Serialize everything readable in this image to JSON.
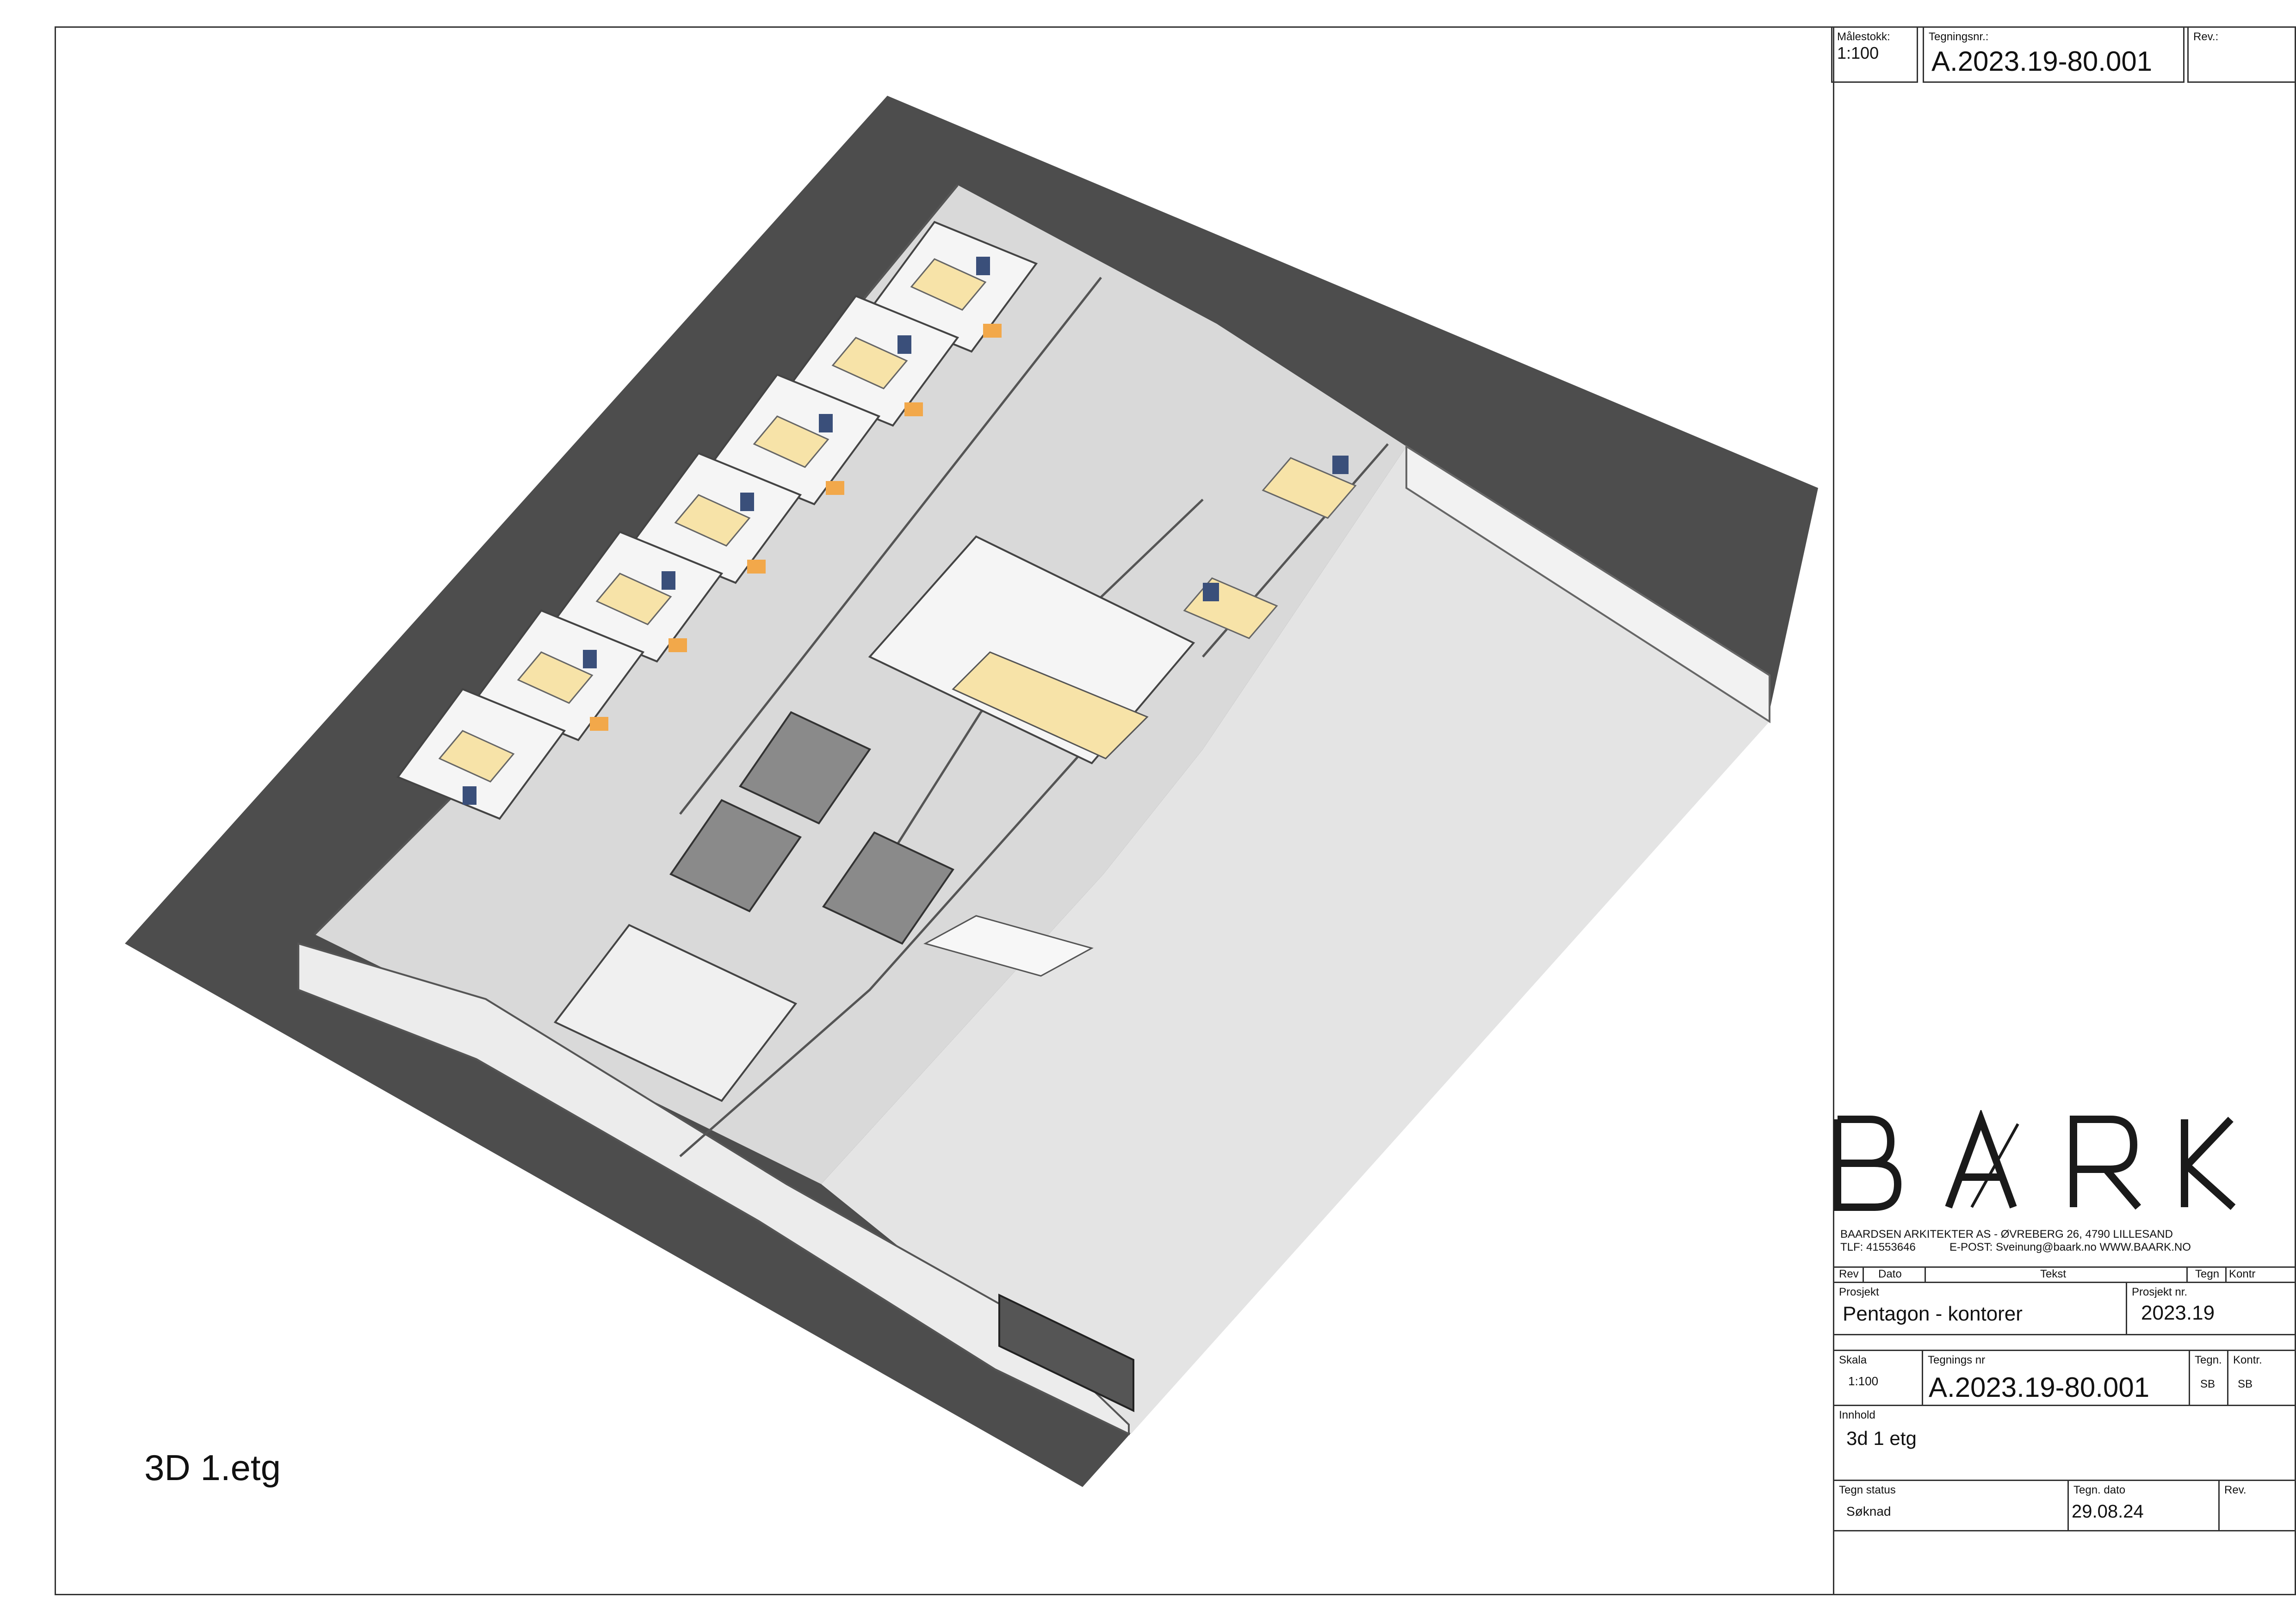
{
  "header": {
    "scale_label": "Målestokk:",
    "scale_value": "1:100",
    "drawing_no_label": "Tegningsnr.:",
    "drawing_no_value": "A.2023.19-80.001",
    "rev_label": "Rev.:"
  },
  "view": {
    "title": "3D 1.etg"
  },
  "logo": {
    "text": "BARK",
    "company_line": "BAARDSEN ARKITEKTER AS - ØVREBERG 26, 4790 LILLESAND",
    "phone": "TLF: 41553646",
    "email_web": "E-POST: Sveinung@baark.no   WWW.BAARK.NO"
  },
  "title_block": {
    "rev_table": {
      "rev": "Rev",
      "dato": "Dato",
      "tekst": "Tekst",
      "tegn": "Tegn",
      "kontr": "Kontr"
    },
    "prosjekt_label": "Prosjekt",
    "prosjekt_value": "Pentagon - kontorer",
    "prosjekt_nr_label": "Prosjekt  nr.",
    "prosjekt_nr_value": "2023.19",
    "skala_label": "Skala",
    "skala_value": "1:100",
    "tegnings_nr_label": "Tegnings nr",
    "tegnings_nr_value": "A.2023.19-80.001",
    "tegn_label": "Tegn.",
    "tegn_value": "SB",
    "kontr_label": "Kontr.",
    "kontr_value": "SB",
    "innhold_label": "Innhold",
    "innhold_value": "3d 1 etg",
    "tegn_status_label": "Tegn status",
    "tegn_status_value": "Søknad",
    "tegn_dato_label": "Tegn. dato",
    "tegn_dato_value": "29.08.24",
    "rev_label": "Rev."
  },
  "colors": {
    "ground": "#4d4d4d",
    "floor": "#e6e6e6",
    "wall_top": "#f4f4f4",
    "wall_side": "#9a9a9a",
    "desk": "#f7e3a8",
    "desk_accent": "#f2a84a",
    "screen": "#3a4f7a"
  }
}
